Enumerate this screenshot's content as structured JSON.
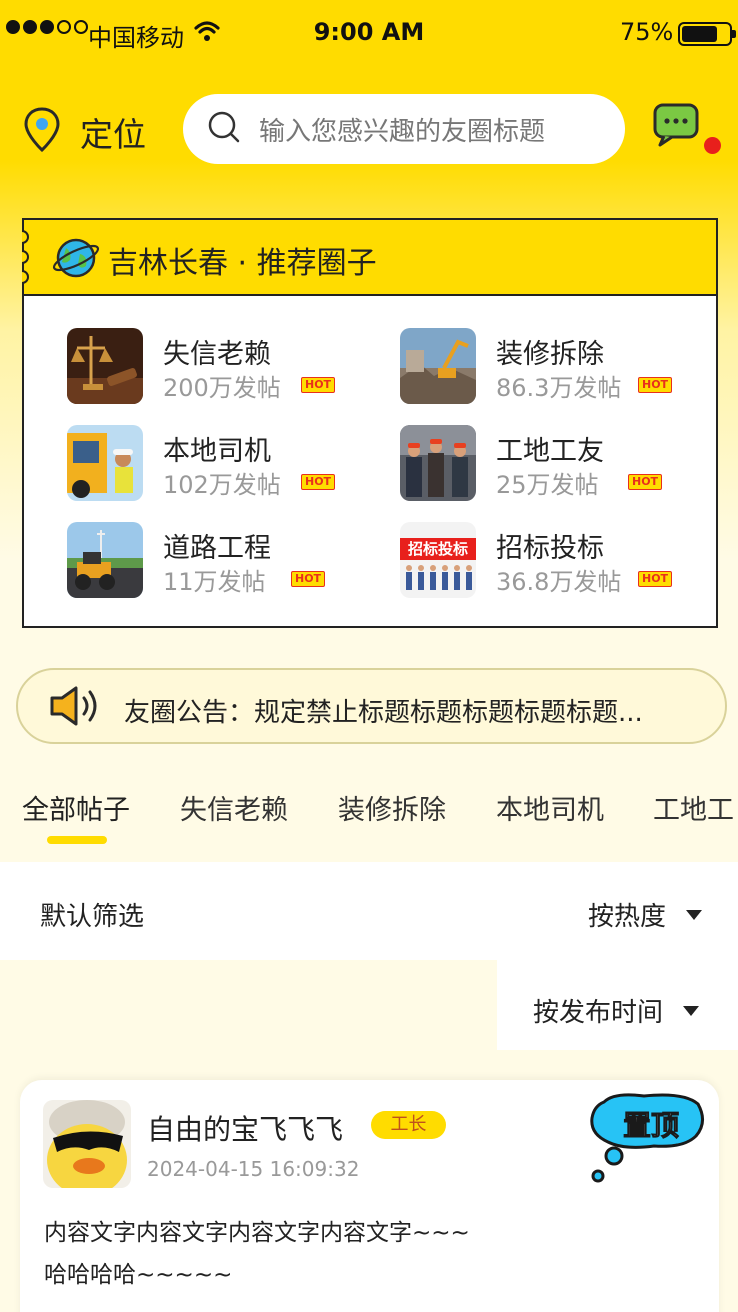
{
  "status_bar": {
    "carrier": "中国移动",
    "time": "9:00 AM",
    "battery_percent": "75%",
    "signal_bars": 3,
    "battery_level": 0.75
  },
  "header": {
    "location_label": "定位",
    "search_placeholder": "输入您感兴趣的友圈标题",
    "has_unread_messages": true
  },
  "recommended": {
    "title": "吉林长春 · 推荐圈子",
    "hot_label": "HOT",
    "circles": [
      {
        "name": "失信老赖",
        "posts": "200万发帖",
        "hot": true
      },
      {
        "name": "装修拆除",
        "posts": "86.3万发帖",
        "hot": true
      },
      {
        "name": "本地司机",
        "posts": "102万发帖",
        "hot": true
      },
      {
        "name": "工地工友",
        "posts": "25万发帖",
        "hot": true
      },
      {
        "name": "道路工程",
        "posts": "11万发帖",
        "hot": true
      },
      {
        "name": "招标投标",
        "posts": "36.8万发帖",
        "hot": true,
        "thumb_text": "招标投标"
      }
    ]
  },
  "notice": {
    "text": "友圈公告：规定禁止标题标题标题标题标题..."
  },
  "tabs": [
    {
      "label": "全部帖子",
      "active": true
    },
    {
      "label": "失信老赖"
    },
    {
      "label": "装修拆除"
    },
    {
      "label": "本地司机"
    },
    {
      "label": "工地工"
    }
  ],
  "filter": {
    "default_label": "默认筛选",
    "sort_selected": "按热度",
    "sort_options": [
      "按发布时间"
    ]
  },
  "post": {
    "username": "自由的宝飞飞飞",
    "role": "工长",
    "time": "2024-04-15  16:09:32",
    "pin_label": "置顶",
    "content_line1": "内容文字内容文字内容文字内容文字~~~",
    "content_line2": "哈哈哈哈~~~~~"
  },
  "colors": {
    "brand_yellow": "#ffdc00",
    "hot_red": "#e8301c",
    "pin_blue": "#27c3f5"
  }
}
